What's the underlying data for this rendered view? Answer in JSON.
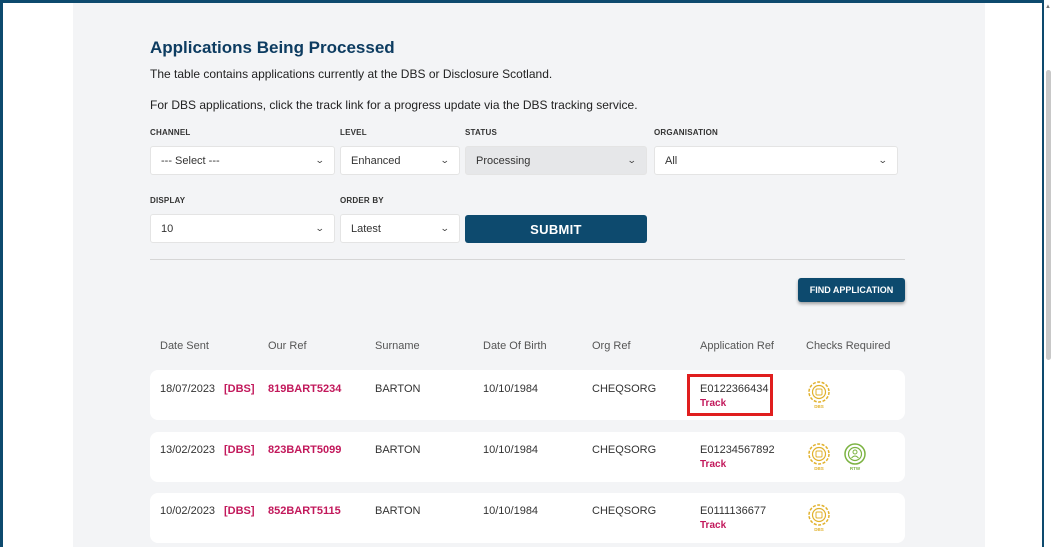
{
  "page": {
    "title": "Applications Being Processed",
    "intro1": "The table contains applications currently at the DBS or Disclosure Scotland.",
    "intro2": "For DBS applications, click the track link for a progress update via the DBS tracking service."
  },
  "filters": {
    "channel": {
      "label": "CHANNEL",
      "value": "--- Select ---"
    },
    "level": {
      "label": "LEVEL",
      "value": "Enhanced"
    },
    "status": {
      "label": "STATUS",
      "value": "Processing"
    },
    "organisation": {
      "label": "ORGANISATION",
      "value": "All"
    },
    "display": {
      "label": "DISPLAY",
      "value": "10"
    },
    "order_by": {
      "label": "ORDER BY",
      "value": "Latest"
    },
    "submit_label": "SUBMIT"
  },
  "find_application_label": "FIND APPLICATION",
  "table": {
    "headers": [
      "Date Sent",
      "Our Ref",
      "Surname",
      "Date Of Birth",
      "Org Ref",
      "Application Ref",
      "Checks Required"
    ],
    "track_label": "Track",
    "rows": [
      {
        "date_sent": "18/07/2023",
        "tag": "[DBS]",
        "our_ref": "819BART5234",
        "surname": "BARTON",
        "dob": "10/10/1984",
        "org_ref": "CHEQSORG",
        "app_ref": "E0122366434",
        "checks": [
          "DBS"
        ]
      },
      {
        "date_sent": "13/02/2023",
        "tag": "[DBS]",
        "our_ref": "823BART5099",
        "surname": "BARTON",
        "dob": "10/10/1984",
        "org_ref": "CHEQSORG",
        "app_ref": "E01234567892",
        "checks": [
          "DBS",
          "RTW"
        ]
      },
      {
        "date_sent": "10/02/2023",
        "tag": "[DBS]",
        "our_ref": "852BART5115",
        "surname": "BARTON",
        "dob": "10/10/1984",
        "org_ref": "CHEQSORG",
        "app_ref": "E0111136677",
        "checks": [
          "DBS"
        ]
      }
    ]
  },
  "colors": {
    "brand": "#0d4a6e",
    "title": "#0d3c61",
    "link": "#c2185b",
    "dbs_badge": "#e1b12c",
    "rtw_badge": "#7cb342",
    "highlight": "#e01e1e"
  }
}
